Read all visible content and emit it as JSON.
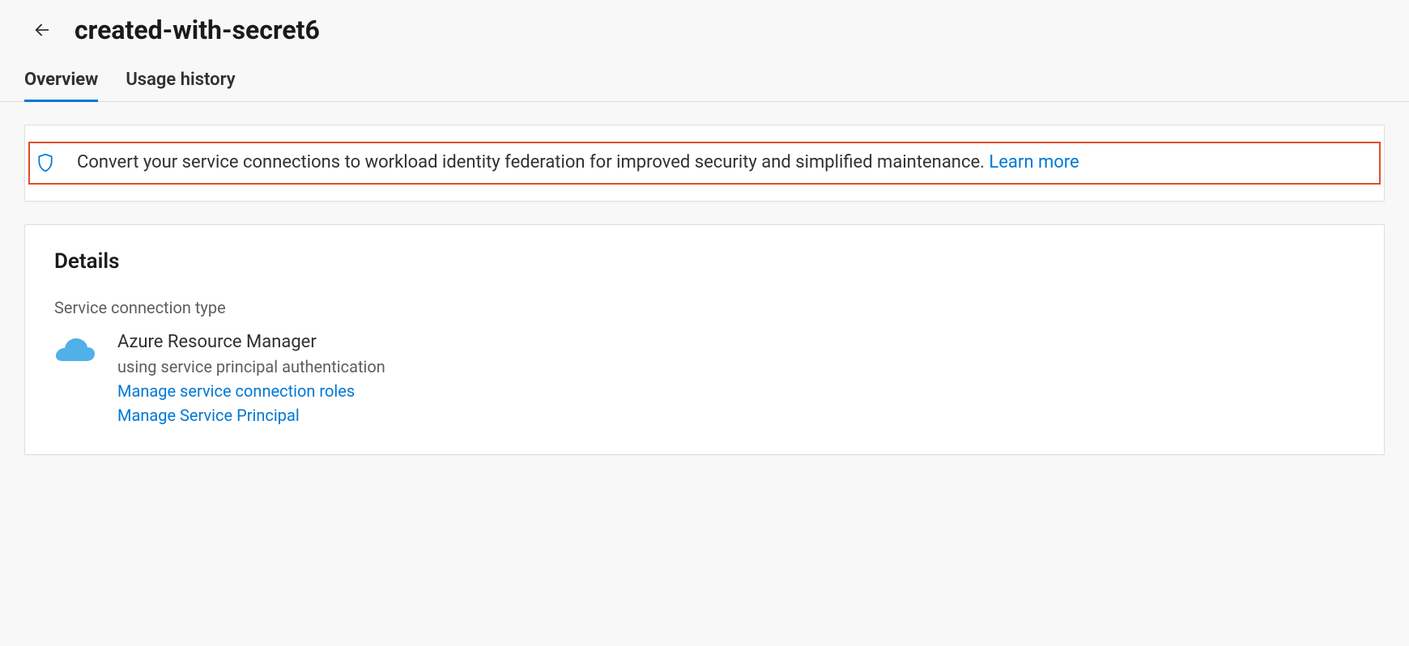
{
  "header": {
    "title": "created-with-secret6"
  },
  "tabs": [
    {
      "label": "Overview",
      "active": true
    },
    {
      "label": "Usage history",
      "active": false
    }
  ],
  "banner": {
    "message": "Convert your service connections to workload identity federation for improved security and simplified maintenance.",
    "learn_more_label": "Learn more"
  },
  "details": {
    "heading": "Details",
    "connection_type_label": "Service connection type",
    "connection": {
      "name": "Azure Resource Manager",
      "subtitle": "using service principal authentication",
      "links": [
        {
          "label": "Manage service connection roles"
        },
        {
          "label": "Manage Service Principal"
        }
      ]
    }
  }
}
